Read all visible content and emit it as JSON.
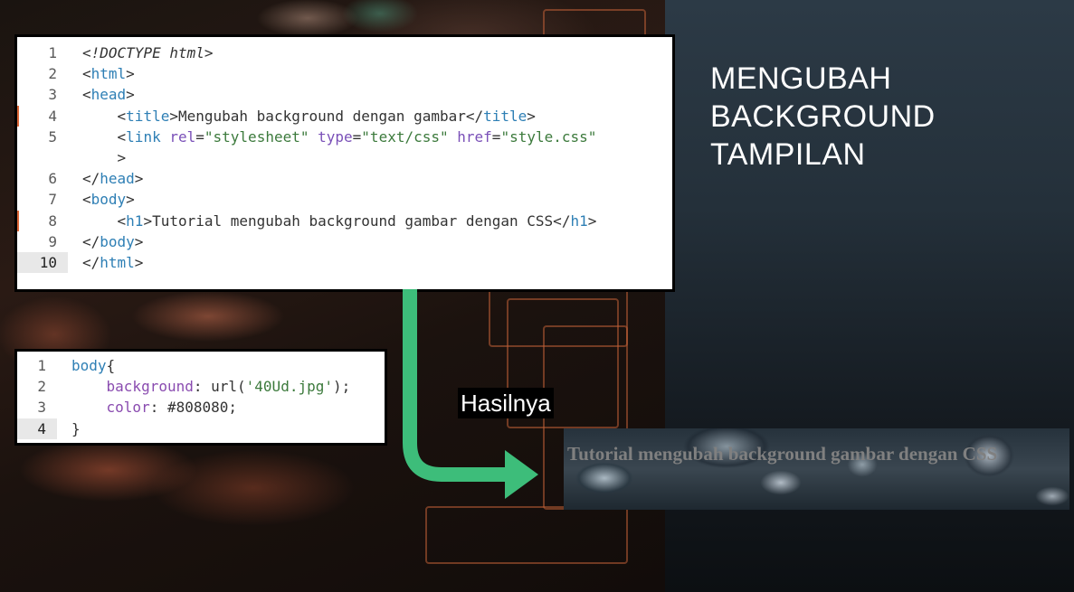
{
  "slide": {
    "title_lines": [
      "MENGUBAH",
      "BACKGROUND",
      "TAMPILAN"
    ]
  },
  "html_code": {
    "lines": [
      {
        "n": "1",
        "parts": [
          [
            "plain",
            "<"
          ],
          [
            "doctype",
            "!DOCTYPE html"
          ],
          [
            "plain",
            ">"
          ]
        ]
      },
      {
        "n": "2",
        "parts": [
          [
            "plain",
            "<"
          ],
          [
            "tag",
            "html"
          ],
          [
            "plain",
            ">"
          ]
        ]
      },
      {
        "n": "3",
        "parts": [
          [
            "plain",
            "<"
          ],
          [
            "tag",
            "head"
          ],
          [
            "plain",
            ">"
          ]
        ]
      },
      {
        "n": "4",
        "parts": [
          [
            "plain",
            "    <"
          ],
          [
            "tag",
            "title"
          ],
          [
            "plain",
            ">Mengubah background dengan gambar</"
          ],
          [
            "tag",
            "title"
          ],
          [
            "plain",
            ">"
          ]
        ]
      },
      {
        "n": "5",
        "parts": [
          [
            "plain",
            "    <"
          ],
          [
            "tag",
            "link"
          ],
          [
            "plain",
            " "
          ],
          [
            "attr",
            "rel"
          ],
          [
            "plain",
            "="
          ],
          [
            "str",
            "\"stylesheet\""
          ],
          [
            "plain",
            " "
          ],
          [
            "attr",
            "type"
          ],
          [
            "plain",
            "="
          ],
          [
            "str",
            "\"text/css\""
          ],
          [
            "plain",
            " "
          ],
          [
            "attr",
            "href"
          ],
          [
            "plain",
            "="
          ],
          [
            "str",
            "\"style.css\""
          ]
        ]
      },
      {
        "n": "",
        "parts": [
          [
            "plain",
            "    >"
          ]
        ]
      },
      {
        "n": "6",
        "parts": [
          [
            "plain",
            "</"
          ],
          [
            "tag",
            "head"
          ],
          [
            "plain",
            ">"
          ]
        ]
      },
      {
        "n": "7",
        "parts": [
          [
            "plain",
            "<"
          ],
          [
            "tag",
            "body"
          ],
          [
            "plain",
            ">"
          ]
        ]
      },
      {
        "n": "8",
        "parts": [
          [
            "plain",
            "    <"
          ],
          [
            "tag",
            "h1"
          ],
          [
            "plain",
            ">Tutorial mengubah background gambar dengan CSS</"
          ],
          [
            "tag",
            "h1"
          ],
          [
            "plain",
            ">"
          ]
        ]
      },
      {
        "n": "9",
        "parts": [
          [
            "plain",
            "</"
          ],
          [
            "tag",
            "body"
          ],
          [
            "plain",
            ">"
          ]
        ]
      },
      {
        "n": "10",
        "parts": [
          [
            "plain",
            "</"
          ],
          [
            "tag",
            "html"
          ],
          [
            "plain",
            ">"
          ]
        ]
      }
    ],
    "active_line": "10",
    "modified_lines": [
      "4",
      "8"
    ]
  },
  "css_code": {
    "lines": [
      {
        "n": "1",
        "parts": [
          [
            "tag",
            "body"
          ],
          [
            "plain",
            "{"
          ]
        ]
      },
      {
        "n": "2",
        "parts": [
          [
            "plain",
            "    "
          ],
          [
            "prop",
            "background"
          ],
          [
            "plain",
            ": url("
          ],
          [
            "str",
            "'40Ud.jpg'"
          ],
          [
            "plain",
            ");"
          ]
        ]
      },
      {
        "n": "3",
        "parts": [
          [
            "plain",
            "    "
          ],
          [
            "prop",
            "color"
          ],
          [
            "plain",
            ": #808080;"
          ]
        ]
      },
      {
        "n": "4",
        "parts": [
          [
            "plain",
            "}"
          ]
        ]
      }
    ],
    "active_line": "4"
  },
  "result": {
    "label": "Hasilnya",
    "heading_text": "Tutorial mengubah background gambar dengan CSS",
    "text_color": "#808080"
  },
  "colors": {
    "arrow": "#3dbd7a",
    "tag": "#2e7fb5",
    "attr": "#7a50b8",
    "string": "#3c7a3c"
  }
}
